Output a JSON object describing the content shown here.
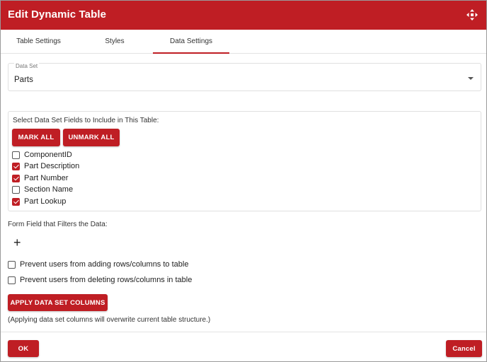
{
  "dialog": {
    "title": "Edit Dynamic Table",
    "move_icon": "move-arrows-icon",
    "accent_color": "#bf1e24"
  },
  "tabs": [
    {
      "label": "Table Settings",
      "active": false
    },
    {
      "label": "Styles",
      "active": false
    },
    {
      "label": "Data Settings",
      "active": true
    }
  ],
  "data_set": {
    "label": "Data Set",
    "value": "Parts"
  },
  "fields": {
    "heading": "Select Data Set Fields to Include in This Table:",
    "mark_all_label": "MARK ALL",
    "unmark_all_label": "UNMARK ALL",
    "items": [
      {
        "label": "ComponentID",
        "checked": false
      },
      {
        "label": "Part Description",
        "checked": true
      },
      {
        "label": "Part Number",
        "checked": true
      },
      {
        "label": "Section Name",
        "checked": false
      },
      {
        "label": "Part Lookup",
        "checked": true
      }
    ]
  },
  "filter": {
    "label": "Form Field that Filters the Data:",
    "add_icon": "plus-icon",
    "add_glyph": "+"
  },
  "options": [
    {
      "label": "Prevent users from adding rows/columns to table",
      "checked": false
    },
    {
      "label": "Prevent users from deleting rows/columns in table",
      "checked": false
    }
  ],
  "apply": {
    "label": "APPLY DATA SET COLUMNS",
    "note": "(Applying data set columns will overwrite current table structure.)"
  },
  "footer": {
    "ok_label": "OK",
    "cancel_label": "Cancel"
  }
}
